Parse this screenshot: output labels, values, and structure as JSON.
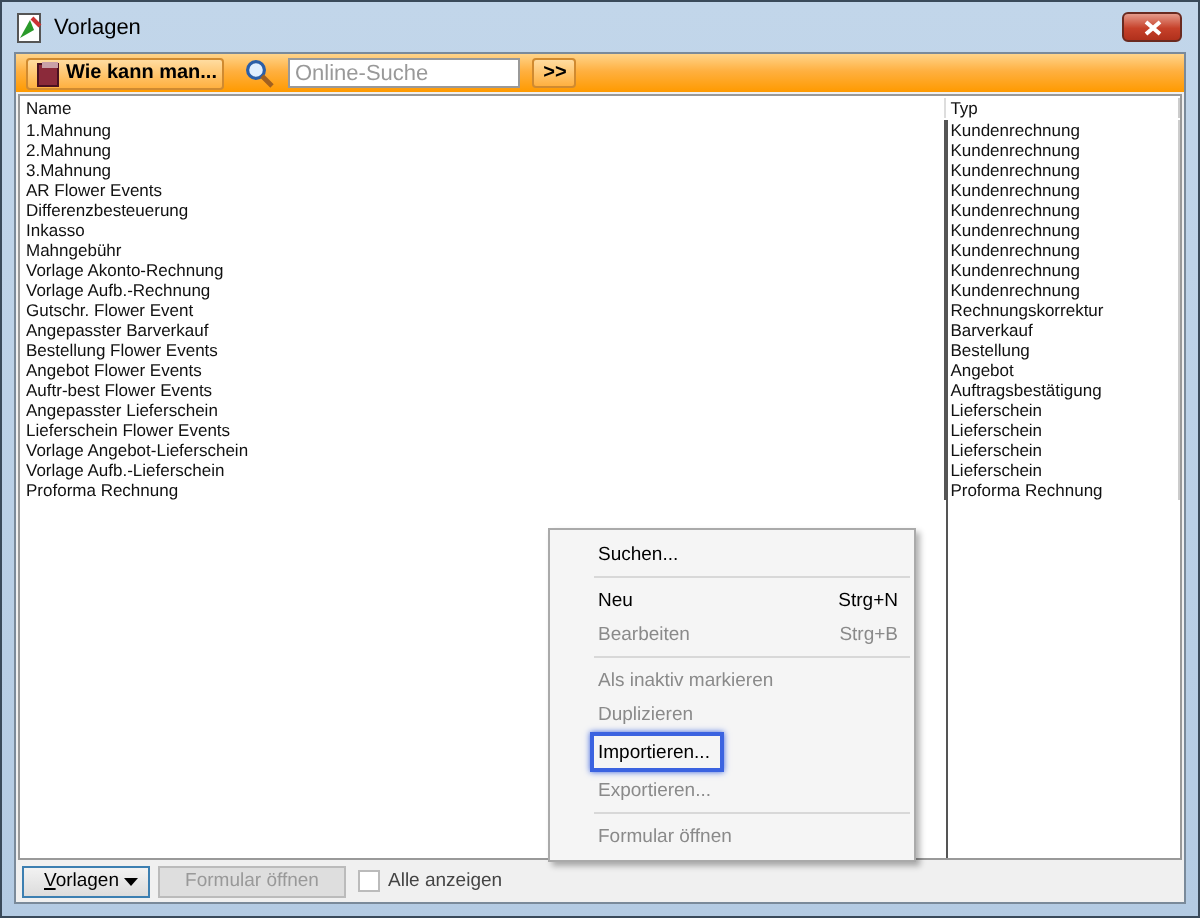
{
  "window": {
    "title": "Vorlagen"
  },
  "toolbar": {
    "help_button": "Wie kann man...",
    "search": {
      "placeholder": "Online-Suche"
    },
    "go_button": ">>"
  },
  "table": {
    "columns": [
      "Name",
      "Typ"
    ],
    "rows": [
      {
        "name": "1.Mahnung",
        "typ": "Kundenrechnung"
      },
      {
        "name": "2.Mahnung",
        "typ": "Kundenrechnung"
      },
      {
        "name": "3.Mahnung",
        "typ": "Kundenrechnung"
      },
      {
        "name": "AR Flower Events",
        "typ": "Kundenrechnung"
      },
      {
        "name": "Differenzbesteuerung",
        "typ": "Kundenrechnung"
      },
      {
        "name": "Inkasso",
        "typ": "Kundenrechnung"
      },
      {
        "name": "Mahngebühr",
        "typ": "Kundenrechnung"
      },
      {
        "name": "Vorlage Akonto-Rechnung",
        "typ": "Kundenrechnung"
      },
      {
        "name": "Vorlage Aufb.-Rechnung",
        "typ": "Kundenrechnung"
      },
      {
        "name": "Gutschr. Flower Event",
        "typ": "Rechnungskorrektur"
      },
      {
        "name": "Angepasster Barverkauf",
        "typ": "Barverkauf"
      },
      {
        "name": "Bestellung Flower Events",
        "typ": "Bestellung"
      },
      {
        "name": "Angebot Flower Events",
        "typ": "Angebot"
      },
      {
        "name": "Auftr-best Flower Events",
        "typ": "Auftragsbestätigung"
      },
      {
        "name": "Angepasster Lieferschein",
        "typ": "Lieferschein"
      },
      {
        "name": "Lieferschein Flower Events",
        "typ": "Lieferschein"
      },
      {
        "name": "Vorlage Angebot-Lieferschein",
        "typ": "Lieferschein"
      },
      {
        "name": "Vorlage Aufb.-Lieferschein",
        "typ": "Lieferschein"
      },
      {
        "name": "Proforma Rechnung",
        "typ": "Proforma Rechnung"
      }
    ]
  },
  "context_menu": [
    {
      "kind": "item",
      "label": "Suchen...",
      "disabled": false,
      "selected": false
    },
    {
      "kind": "separator"
    },
    {
      "kind": "item",
      "label": "Neu",
      "shortcut": "Strg+N",
      "disabled": false,
      "selected": false
    },
    {
      "kind": "item",
      "label": "Bearbeiten",
      "shortcut": "Strg+B",
      "disabled": true,
      "selected": false
    },
    {
      "kind": "separator"
    },
    {
      "kind": "item",
      "label": "Als inaktiv markieren",
      "disabled": true,
      "selected": false
    },
    {
      "kind": "item",
      "label": "Duplizieren",
      "disabled": true,
      "selected": false
    },
    {
      "kind": "item",
      "label": "Importieren...",
      "disabled": false,
      "selected": true
    },
    {
      "kind": "item",
      "label": "Exportieren...",
      "disabled": true,
      "selected": false
    },
    {
      "kind": "separator"
    },
    {
      "kind": "item",
      "label": "Formular öffnen",
      "disabled": true,
      "selected": false
    }
  ],
  "bottom_bar": {
    "menu_button": "Vorlagen",
    "open_button": {
      "label": "Formular öffnen",
      "disabled": true
    },
    "show_all": {
      "label": "Alle anzeigen",
      "checked": false
    }
  }
}
